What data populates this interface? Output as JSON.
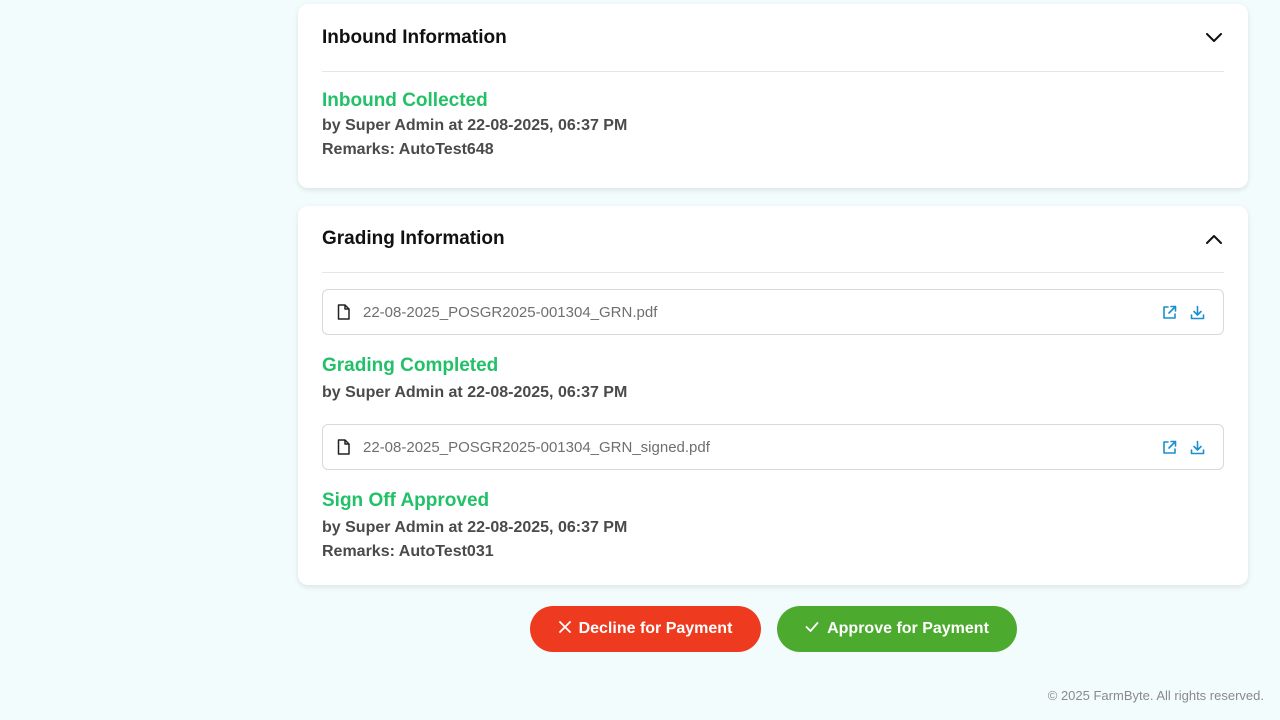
{
  "inbound": {
    "title": "Inbound Information",
    "chevron_icon": "chevron-down-icon",
    "status": "Inbound Collected",
    "by_line": "by Super Admin at 22-08-2025, 06:37 PM",
    "remarks": "Remarks: AutoTest648"
  },
  "grading": {
    "title": "Grading Information",
    "chevron_icon": "chevron-up-icon",
    "files": [
      {
        "name": "22-08-2025_POSGR2025-001304_GRN.pdf"
      },
      {
        "name": "22-08-2025_POSGR2025-001304_GRN_signed.pdf"
      }
    ],
    "grading_status": "Grading Completed",
    "grading_by_line": "by Super Admin at 22-08-2025, 06:37 PM",
    "signoff_status": "Sign Off Approved",
    "signoff_by_line": "by Super Admin at 22-08-2025, 06:37 PM",
    "signoff_remarks": "Remarks: AutoTest031"
  },
  "actions": {
    "decline_label": "Decline for Payment",
    "approve_label": "Approve for Payment"
  },
  "footer": {
    "text": "© 2025 FarmByte. All rights reserved."
  },
  "colors": {
    "status_green": "#22c168",
    "decline_red": "#ee3a1e",
    "approve_green": "#4caa2f",
    "link_blue": "#1a8fd1"
  }
}
